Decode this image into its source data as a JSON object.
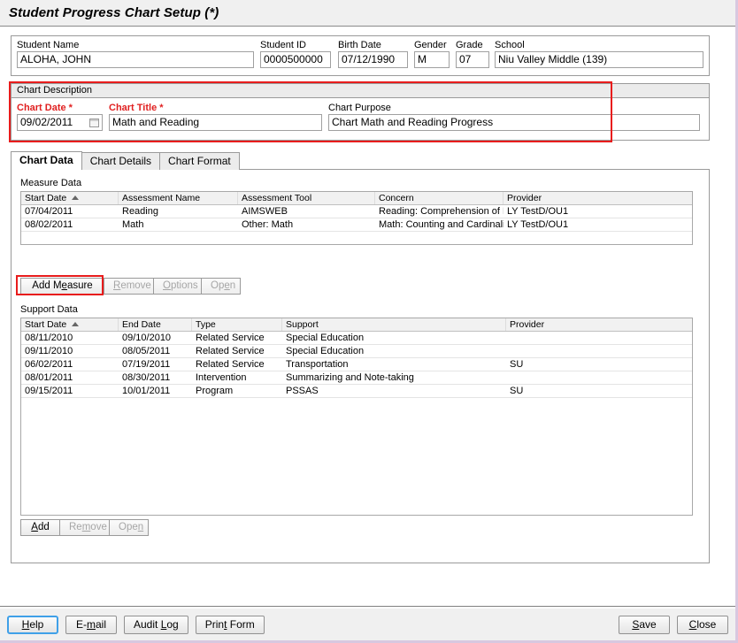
{
  "window": {
    "title": "Student Progress Chart Setup (*)"
  },
  "student": {
    "name_label": "Student Name",
    "name_value": "ALOHA, JOHN",
    "id_label": "Student ID",
    "id_value": "0000500000",
    "birth_label": "Birth Date",
    "birth_value": "07/12/1990",
    "gender_label": "Gender",
    "gender_value": "M",
    "grade_label": "Grade",
    "grade_value": "07",
    "school_label": "School",
    "school_value": "Niu Valley Middle (139)"
  },
  "chart_description": {
    "caption": "Chart Description",
    "date_label": "Chart Date *",
    "date_value": "09/02/2011",
    "title_label": "Chart Title *",
    "title_value": "Math and Reading",
    "purpose_label": "Chart Purpose",
    "purpose_value": "Chart Math and Reading Progress",
    "highlight_color": "#e81c1c",
    "required_color": "#e02020"
  },
  "tabs": [
    {
      "label": "Chart Data",
      "active": true
    },
    {
      "label": "Chart Details",
      "active": false
    },
    {
      "label": "Chart Format",
      "active": false
    }
  ],
  "measure_data": {
    "section_label": "Measure Data",
    "columns": [
      "Start Date",
      "Assessment Name",
      "Assessment Tool",
      "Concern",
      "Provider"
    ],
    "sorted_column": "Start Date",
    "sort_direction": "ascending",
    "rows": [
      {
        "start_date": "07/04/2011",
        "assessment_name": "Reading",
        "assessment_tool": "AIMSWEB",
        "concern": "Reading: Comprehension of Li",
        "provider": "LY TestD/OU1"
      },
      {
        "start_date": "08/02/2011",
        "assessment_name": "Math",
        "assessment_tool": "Other: Math",
        "concern": "Math: Counting and Cardinalit",
        "provider": "LY TestD/OU1"
      }
    ],
    "buttons": [
      {
        "label": "Add Measure",
        "mnemonic": "a",
        "enabled": true,
        "highlighted": true
      },
      {
        "label": "Remove",
        "mnemonic": "R",
        "enabled": false,
        "highlighted": false
      },
      {
        "label": "Options",
        "mnemonic": "O",
        "enabled": false,
        "highlighted": false
      },
      {
        "label": "Open",
        "mnemonic": "O",
        "enabled": false,
        "highlighted": false
      }
    ]
  },
  "support_data": {
    "section_label": "Support Data",
    "columns": [
      "Start Date",
      "End Date",
      "Type",
      "Support",
      "Provider"
    ],
    "sorted_column": "Start Date",
    "sort_direction": "ascending",
    "rows": [
      {
        "start_date": "08/11/2010",
        "end_date": "09/10/2010",
        "type": "Related Service",
        "support": "Special Education",
        "provider": ""
      },
      {
        "start_date": "09/11/2010",
        "end_date": "08/05/2011",
        "type": "Related Service",
        "support": "Special Education",
        "provider": ""
      },
      {
        "start_date": "06/02/2011",
        "end_date": "07/19/2011",
        "type": "Related Service",
        "support": "Transportation",
        "provider": "SU"
      },
      {
        "start_date": "08/01/2011",
        "end_date": "08/30/2011",
        "type": "Intervention",
        "support": "Summarizing and Note-taking",
        "provider": ""
      },
      {
        "start_date": "09/15/2011",
        "end_date": "10/01/2011",
        "type": "Program",
        "support": "PSSAS",
        "provider": "SU"
      }
    ],
    "buttons": [
      {
        "label": "Add",
        "enabled": true
      },
      {
        "label": "Remove",
        "enabled": false
      },
      {
        "label": "Open",
        "enabled": false
      }
    ]
  },
  "footer": {
    "left_buttons": [
      {
        "label": "Help",
        "focused": true
      },
      {
        "label": "E-mail",
        "focused": false
      },
      {
        "label": "Audit Log",
        "focused": false
      },
      {
        "label": "Print Form",
        "focused": false
      }
    ],
    "right_buttons": [
      {
        "label": "Save",
        "focused": false
      },
      {
        "label": "Close",
        "focused": false
      }
    ]
  }
}
